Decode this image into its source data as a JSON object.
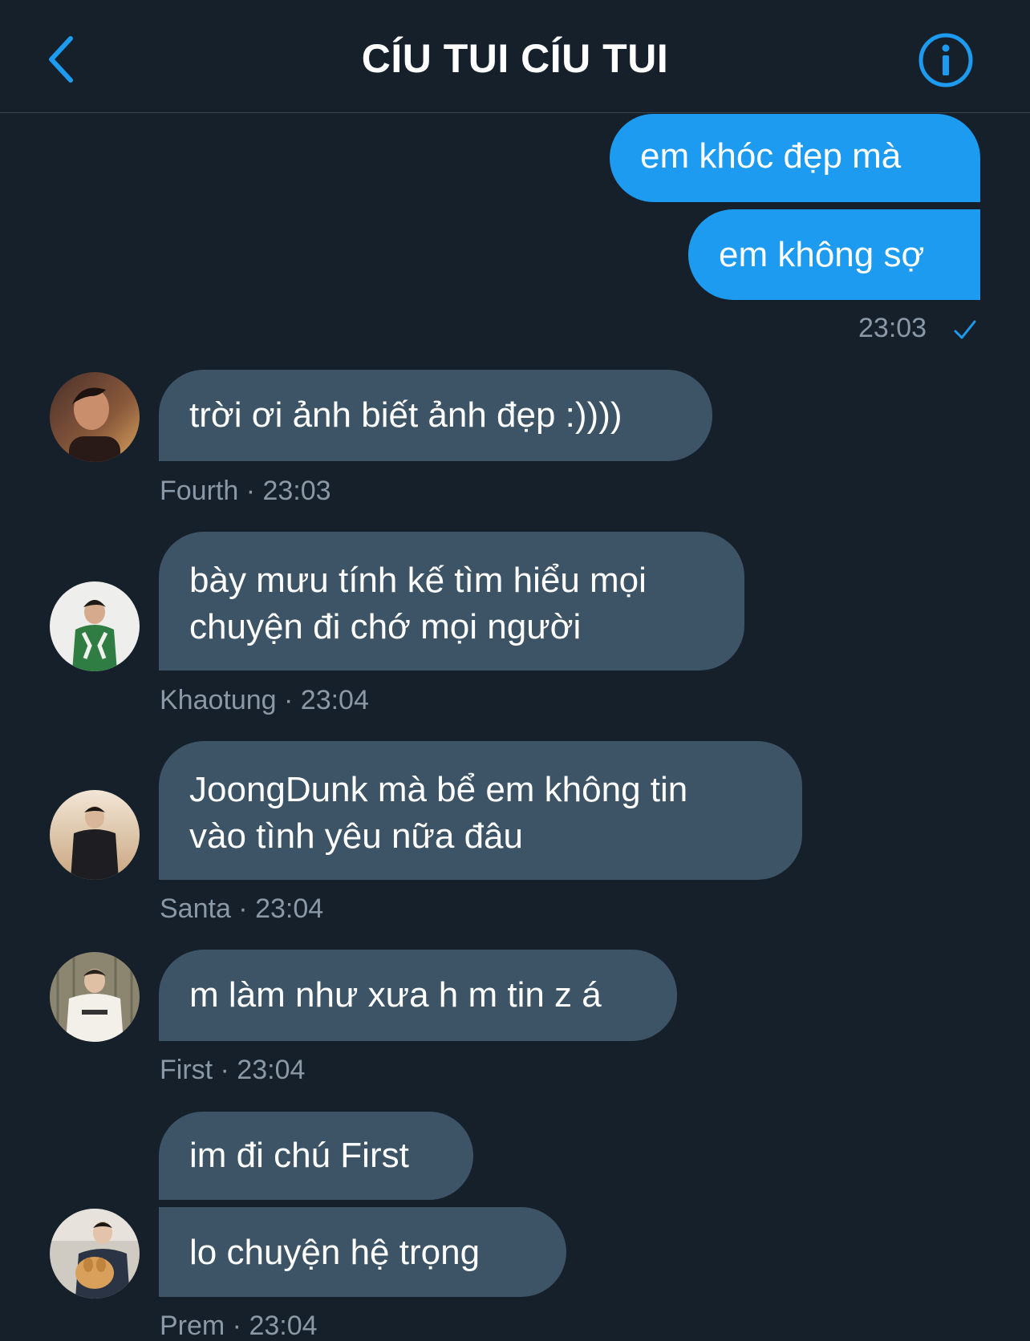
{
  "header": {
    "title": "CÍU TUI CÍU TUI",
    "back_icon": "chevron-left-icon",
    "info_icon": "info-circle-icon",
    "accent_color": "#1d9bf0"
  },
  "outgoing": {
    "messages": [
      "em khóc đẹp mà",
      "em không sợ"
    ],
    "time": "23:03",
    "status_icon": "checkmark-icon"
  },
  "incoming": [
    {
      "sender": "Fourth",
      "time": "23:03",
      "lines": [
        "trời ơi ảnh biết ảnh đẹp :))))"
      ],
      "meta": "Fourth · 23:03"
    },
    {
      "sender": "Khaotung",
      "time": "23:04",
      "lines": [
        "bày mưu tính kế tìm hiểu mọi",
        "chuyện đi chớ mọi người"
      ],
      "meta": "Khaotung · 23:04"
    },
    {
      "sender": "Santa",
      "time": "23:04",
      "lines": [
        "JoongDunk mà bể em không tin",
        "vào tình yêu nữa đâu"
      ],
      "meta": "Santa · 23:04"
    },
    {
      "sender": "First",
      "time": "23:04",
      "lines": [
        "m làm như xưa h m tin z á"
      ],
      "meta": "First · 23:04"
    },
    {
      "sender": "Prem",
      "time": "23:04",
      "lines": [
        "im đi chú First"
      ],
      "lines2": [
        "lo chuyện hệ trọng"
      ],
      "meta": "Prem · 23:04"
    }
  ]
}
